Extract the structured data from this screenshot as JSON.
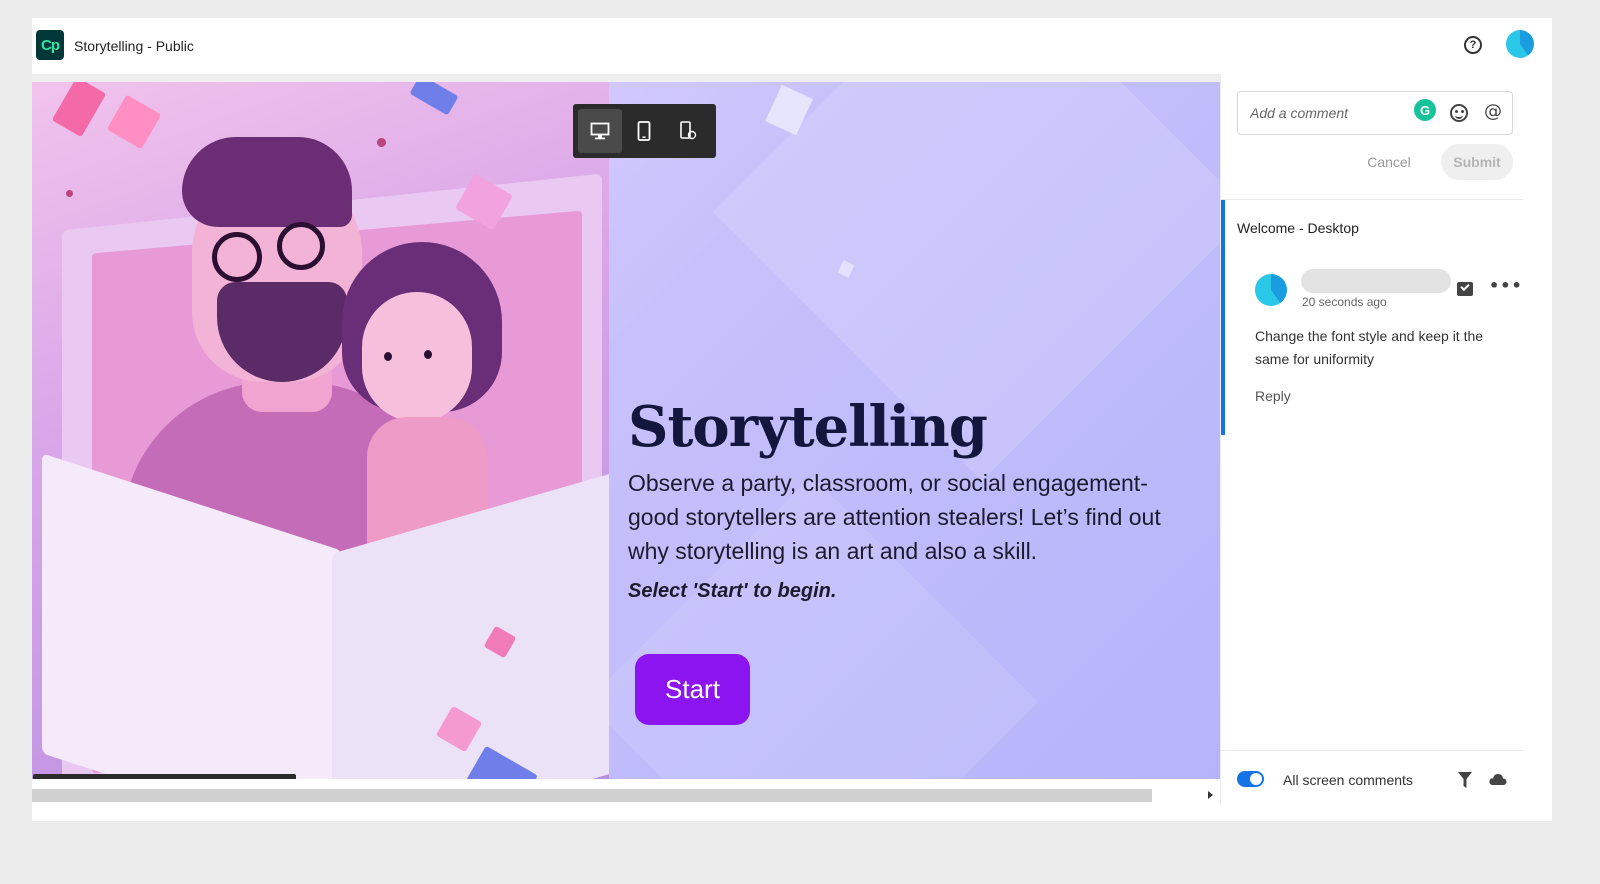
{
  "app": {
    "logo_text": "Cp",
    "title": "Storytelling - Public",
    "help_glyph": "?",
    "icons": {
      "help": "help-icon",
      "avatar": "user-avatar"
    }
  },
  "device_toolbar": {
    "buttons": [
      {
        "name": "desktop-view",
        "icon": "desktop-icon",
        "active": true
      },
      {
        "name": "tablet-view",
        "icon": "tablet-icon",
        "active": false
      },
      {
        "name": "mobile-rotate-view",
        "icon": "mobile-rotate-icon",
        "active": false
      }
    ]
  },
  "slide": {
    "title": "Storytelling",
    "body": "Observe a party, classroom, or social engagement- good storytellers are attention stealers! Let’s find out why storytelling is an art and also a skill.",
    "prompt": "Select 'Start' to begin.",
    "start_label": "Start",
    "colors": {
      "start_button": "#8c14f0",
      "title": "#14163d"
    }
  },
  "playbar": {
    "buttons": [
      "play-icon",
      "rewind-icon",
      "next-slide-icon",
      "volume-icon",
      "toc-menu-icon",
      "collapse-chevron-icon"
    ]
  },
  "comments_panel": {
    "placeholder": "Add a comment",
    "grammarly_glyph": "G",
    "mention_glyph": "@",
    "cancel_label": "Cancel",
    "submit_label": "Submit",
    "thread": {
      "title": "Welcome - Desktop",
      "time": "20 seconds ago",
      "text": "Change the font style and keep it the same for uniformity",
      "reply_label": "Reply",
      "more_glyph": "•••"
    },
    "footer": {
      "toggle_on": true,
      "label": "All screen comments"
    },
    "colors": {
      "accent": "#1473e6"
    }
  }
}
